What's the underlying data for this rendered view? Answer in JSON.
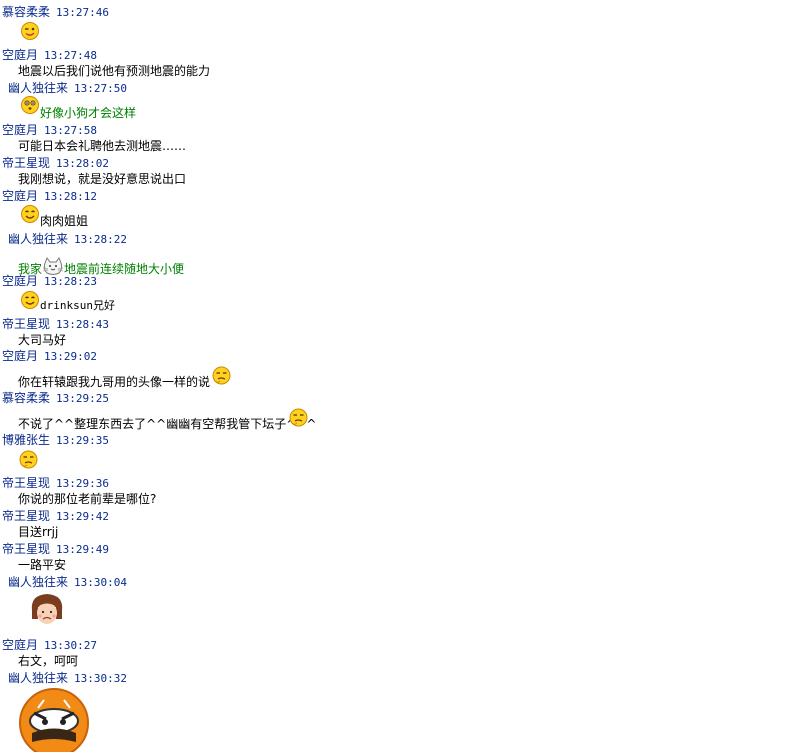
{
  "messages": [
    {
      "sender": "慕容柔柔",
      "time": "13:27:46"
    },
    {
      "sender": "空庭月",
      "time": "13:27:48",
      "text": "地震以后我们说他有预测地震的能力"
    },
    {
      "sender": "幽人独往来",
      "time": "13:27:50",
      "text": "好像小狗才会这样"
    },
    {
      "sender": "空庭月",
      "time": "13:27:58",
      "text": "可能日本会礼聘他去测地震……"
    },
    {
      "sender": "帝王星现",
      "time": "13:28:02",
      "text": "我刚想说，就是没好意思说出口"
    },
    {
      "sender": "空庭月",
      "time": "13:28:12",
      "text": "肉肉姐姐"
    },
    {
      "sender": "幽人独往来",
      "time": "13:28:22",
      "text_a": "我家",
      "text_b": "地震前连续随地大小便"
    },
    {
      "sender": "空庭月",
      "time": "13:28:23",
      "text": "drinksun兄好"
    },
    {
      "sender": "帝王星现",
      "time": "13:28:43",
      "text": "大司马好"
    },
    {
      "sender": "空庭月",
      "time": "13:29:02",
      "text": "你在轩辕跟我九哥用的头像一样的说"
    },
    {
      "sender": "慕容柔柔",
      "time": "13:29:25",
      "text": "不说了^^整理东西去了^^幽幽有空帮我管下坛子^^^"
    },
    {
      "sender": "博雅张生",
      "time": "13:29:35"
    },
    {
      "sender": "帝王星现",
      "time": "13:29:36",
      "text": "你说的那位老前辈是哪位?"
    },
    {
      "sender": "帝王星现",
      "time": "13:29:42",
      "text": "目送rrjj"
    },
    {
      "sender": "帝王星现",
      "time": "13:29:49",
      "text": "一路平安"
    },
    {
      "sender": "幽人独往来",
      "time": "13:30:04"
    },
    {
      "sender": "空庭月",
      "time": "13:30:27",
      "text": "右文，呵呵"
    },
    {
      "sender": "幽人独往来",
      "time": "13:30:32"
    }
  ]
}
